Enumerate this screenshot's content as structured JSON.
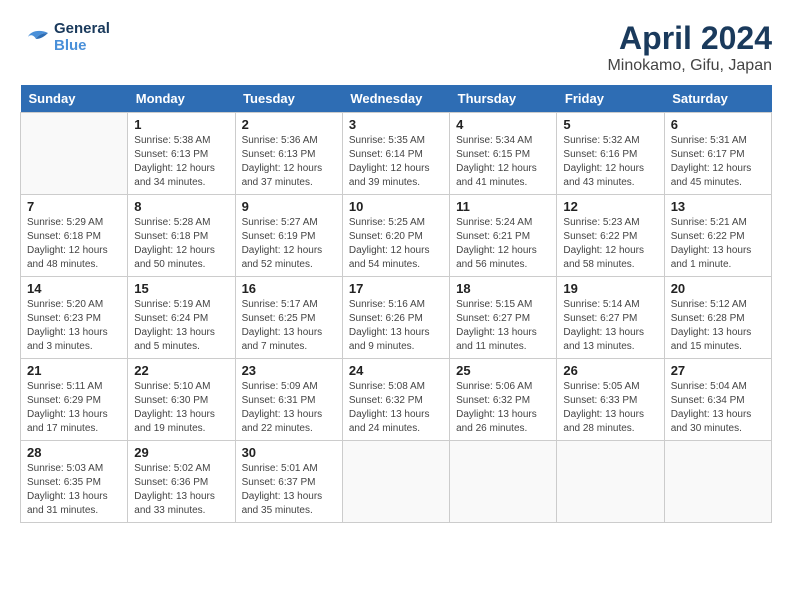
{
  "header": {
    "logo_line1": "General",
    "logo_line2": "Blue",
    "month": "April 2024",
    "location": "Minokamo, Gifu, Japan"
  },
  "weekdays": [
    "Sunday",
    "Monday",
    "Tuesday",
    "Wednesday",
    "Thursday",
    "Friday",
    "Saturday"
  ],
  "weeks": [
    [
      {
        "day": "",
        "info": ""
      },
      {
        "day": "1",
        "info": "Sunrise: 5:38 AM\nSunset: 6:13 PM\nDaylight: 12 hours\nand 34 minutes."
      },
      {
        "day": "2",
        "info": "Sunrise: 5:36 AM\nSunset: 6:13 PM\nDaylight: 12 hours\nand 37 minutes."
      },
      {
        "day": "3",
        "info": "Sunrise: 5:35 AM\nSunset: 6:14 PM\nDaylight: 12 hours\nand 39 minutes."
      },
      {
        "day": "4",
        "info": "Sunrise: 5:34 AM\nSunset: 6:15 PM\nDaylight: 12 hours\nand 41 minutes."
      },
      {
        "day": "5",
        "info": "Sunrise: 5:32 AM\nSunset: 6:16 PM\nDaylight: 12 hours\nand 43 minutes."
      },
      {
        "day": "6",
        "info": "Sunrise: 5:31 AM\nSunset: 6:17 PM\nDaylight: 12 hours\nand 45 minutes."
      }
    ],
    [
      {
        "day": "7",
        "info": "Sunrise: 5:29 AM\nSunset: 6:18 PM\nDaylight: 12 hours\nand 48 minutes."
      },
      {
        "day": "8",
        "info": "Sunrise: 5:28 AM\nSunset: 6:18 PM\nDaylight: 12 hours\nand 50 minutes."
      },
      {
        "day": "9",
        "info": "Sunrise: 5:27 AM\nSunset: 6:19 PM\nDaylight: 12 hours\nand 52 minutes."
      },
      {
        "day": "10",
        "info": "Sunrise: 5:25 AM\nSunset: 6:20 PM\nDaylight: 12 hours\nand 54 minutes."
      },
      {
        "day": "11",
        "info": "Sunrise: 5:24 AM\nSunset: 6:21 PM\nDaylight: 12 hours\nand 56 minutes."
      },
      {
        "day": "12",
        "info": "Sunrise: 5:23 AM\nSunset: 6:22 PM\nDaylight: 12 hours\nand 58 minutes."
      },
      {
        "day": "13",
        "info": "Sunrise: 5:21 AM\nSunset: 6:22 PM\nDaylight: 13 hours\nand 1 minute."
      }
    ],
    [
      {
        "day": "14",
        "info": "Sunrise: 5:20 AM\nSunset: 6:23 PM\nDaylight: 13 hours\nand 3 minutes."
      },
      {
        "day": "15",
        "info": "Sunrise: 5:19 AM\nSunset: 6:24 PM\nDaylight: 13 hours\nand 5 minutes."
      },
      {
        "day": "16",
        "info": "Sunrise: 5:17 AM\nSunset: 6:25 PM\nDaylight: 13 hours\nand 7 minutes."
      },
      {
        "day": "17",
        "info": "Sunrise: 5:16 AM\nSunset: 6:26 PM\nDaylight: 13 hours\nand 9 minutes."
      },
      {
        "day": "18",
        "info": "Sunrise: 5:15 AM\nSunset: 6:27 PM\nDaylight: 13 hours\nand 11 minutes."
      },
      {
        "day": "19",
        "info": "Sunrise: 5:14 AM\nSunset: 6:27 PM\nDaylight: 13 hours\nand 13 minutes."
      },
      {
        "day": "20",
        "info": "Sunrise: 5:12 AM\nSunset: 6:28 PM\nDaylight: 13 hours\nand 15 minutes."
      }
    ],
    [
      {
        "day": "21",
        "info": "Sunrise: 5:11 AM\nSunset: 6:29 PM\nDaylight: 13 hours\nand 17 minutes."
      },
      {
        "day": "22",
        "info": "Sunrise: 5:10 AM\nSunset: 6:30 PM\nDaylight: 13 hours\nand 19 minutes."
      },
      {
        "day": "23",
        "info": "Sunrise: 5:09 AM\nSunset: 6:31 PM\nDaylight: 13 hours\nand 22 minutes."
      },
      {
        "day": "24",
        "info": "Sunrise: 5:08 AM\nSunset: 6:32 PM\nDaylight: 13 hours\nand 24 minutes."
      },
      {
        "day": "25",
        "info": "Sunrise: 5:06 AM\nSunset: 6:32 PM\nDaylight: 13 hours\nand 26 minutes."
      },
      {
        "day": "26",
        "info": "Sunrise: 5:05 AM\nSunset: 6:33 PM\nDaylight: 13 hours\nand 28 minutes."
      },
      {
        "day": "27",
        "info": "Sunrise: 5:04 AM\nSunset: 6:34 PM\nDaylight: 13 hours\nand 30 minutes."
      }
    ],
    [
      {
        "day": "28",
        "info": "Sunrise: 5:03 AM\nSunset: 6:35 PM\nDaylight: 13 hours\nand 31 minutes."
      },
      {
        "day": "29",
        "info": "Sunrise: 5:02 AM\nSunset: 6:36 PM\nDaylight: 13 hours\nand 33 minutes."
      },
      {
        "day": "30",
        "info": "Sunrise: 5:01 AM\nSunset: 6:37 PM\nDaylight: 13 hours\nand 35 minutes."
      },
      {
        "day": "",
        "info": ""
      },
      {
        "day": "",
        "info": ""
      },
      {
        "day": "",
        "info": ""
      },
      {
        "day": "",
        "info": ""
      }
    ]
  ]
}
